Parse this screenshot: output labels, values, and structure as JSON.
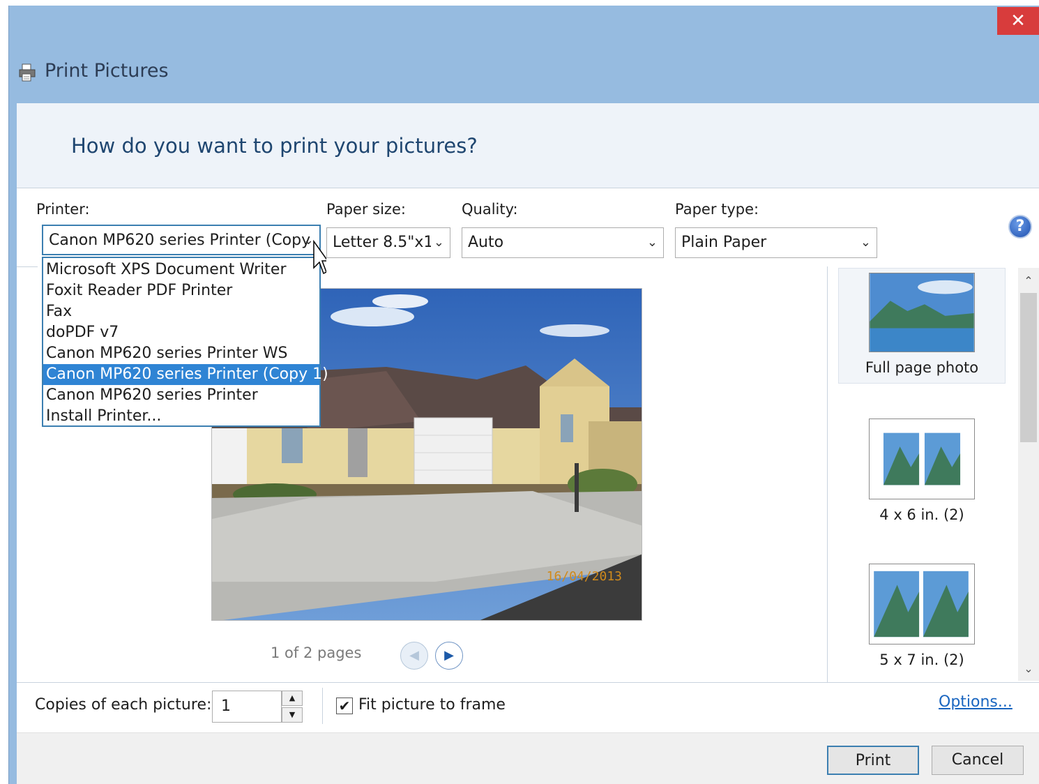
{
  "window": {
    "title": "Print Pictures",
    "close_glyph": "✕"
  },
  "header": {
    "question": "How do you want to print your pictures?"
  },
  "settings": {
    "printer_label": "Printer:",
    "printer_value": "Canon MP620 series Printer (Copy",
    "paper_size_label": "Paper size:",
    "paper_size_value": "Letter 8.5\"x1",
    "quality_label": "Quality:",
    "quality_value": "Auto",
    "paper_type_label": "Paper type:",
    "paper_type_value": "Plain Paper",
    "help_glyph": "?"
  },
  "printer_dropdown": {
    "items": [
      "Microsoft XPS Document Writer",
      "Foxit Reader PDF Printer",
      "Fax",
      "doPDF v7",
      "Canon MP620 series Printer WS",
      "Canon MP620 series Printer (Copy 1)",
      "Canon MP620 series Printer",
      "Install Printer..."
    ],
    "selected_index": 5
  },
  "preview": {
    "date_stamp": "16/04/2013",
    "page_count": "1 of 2 pages"
  },
  "layouts": [
    {
      "caption": "Full page photo",
      "selected": true
    },
    {
      "caption": "4 x 6 in. (2)",
      "selected": false
    },
    {
      "caption": "5 x 7 in. (2)",
      "selected": false
    }
  ],
  "copies": {
    "label": "Copies of each picture:",
    "value": "1"
  },
  "fit_to_frame": {
    "label": "Fit picture to frame",
    "checked": true,
    "check_glyph": "✔"
  },
  "options_link": "Options...",
  "buttons": {
    "print": "Print",
    "cancel": "Cancel"
  },
  "colors": {
    "titlebar": "#96bbe0",
    "close": "#d83c3c",
    "selection": "#2f84d4",
    "link": "#1a66c0"
  }
}
